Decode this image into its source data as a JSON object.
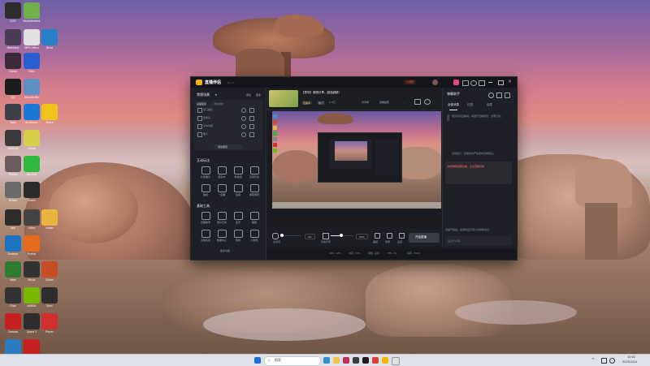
{
  "desktop": {
    "icons": [
      {
        "label": "iQIYI",
        "color": "#2c2c2c"
      },
      {
        "label": "BaiduNetdisk",
        "color": "#6fb04b"
      },
      {
        "label": "Mainland",
        "color": "#4a3c55"
      },
      {
        "label": "WPS Office",
        "color": "#e0e0e0"
      },
      {
        "label": "Drive",
        "color": "#2a80c8"
      },
      {
        "label": "Game",
        "color": "#3b2b3b"
      },
      {
        "label": "Files",
        "color": "#2a5fd1"
      },
      {
        "label": "QQ",
        "color": "#1d1d1d"
      },
      {
        "label": "Recycle Bin",
        "color": "#5e8fc4"
      },
      {
        "label": "Tools",
        "color": "#3d3f49"
      },
      {
        "label": "Bluetooth",
        "color": "#1b79d6"
      },
      {
        "label": "Share",
        "color": "#f0c21a"
      },
      {
        "label": "Settings",
        "color": "#3a3a3a"
      },
      {
        "label": "Guide",
        "color": "#d6cf4a"
      },
      {
        "label": "Photos",
        "color": "#6a5c5c"
      },
      {
        "label": "WeChat",
        "color": "#2fb93c"
      },
      {
        "label": "Helper",
        "color": "#6a6a6a"
      },
      {
        "label": "Zoom",
        "color": "#2b2b2b"
      },
      {
        "label": "App",
        "color": "#2c2c2c"
      },
      {
        "label": "Video",
        "color": "#444"
      },
      {
        "label": "Folder",
        "color": "#e8b43c"
      },
      {
        "label": "Browser",
        "color": "#1d73c2"
      },
      {
        "label": "Firefox",
        "color": "#e66a1c"
      },
      {
        "label": "Note",
        "color": "#2e7d32"
      },
      {
        "label": "Music",
        "color": "#333"
      },
      {
        "label": "Slides",
        "color": "#c74b25"
      },
      {
        "label": "Chat",
        "color": "#333"
      },
      {
        "label": "NVIDIA",
        "color": "#76b900"
      },
      {
        "label": "Sync",
        "color": "#2e2e2e"
      },
      {
        "label": "Camera",
        "color": "#c42020"
      },
      {
        "label": "Game 2",
        "color": "#2e2e2e"
      },
      {
        "label": "Player",
        "color": "#d32f2f"
      },
      {
        "label": "Calc",
        "color": "#2b7bc0"
      },
      {
        "label": "Reader",
        "color": "#c61f1f"
      }
    ]
  },
  "app": {
    "title": "直播伴侣",
    "version": "9.1.3",
    "top_badge": "十周年",
    "room_title": "【秀场】美照分享，越选越精！",
    "tag_live": "直播中",
    "tag_share": "热门",
    "tag_count": "1.2万",
    "btn_edit": "分享场",
    "btn_rank": "观看指南",
    "btn_more": "…",
    "scene_header": "常规场景",
    "add_label": "添加",
    "more_label": "更多",
    "scene_list_title": "画面图层",
    "scene_list_sub": "添加素材",
    "scene_items": [
      "窗口捕获",
      "摄像头",
      "文本内容",
      "图片"
    ],
    "add_scene_btn": "添加图层",
    "interact_title": "互动玩法",
    "interact_items": [
      "礼物展示",
      "连麦PK",
      "粉丝团",
      "互动玩法",
      "抽奖",
      "一起看",
      "投票",
      "弹幕游戏"
    ],
    "tools_title": "基础工具",
    "tools_items": [
      "直播助手",
      "观众互动",
      "金币",
      "美颜",
      "主播任务",
      "数据中心",
      "特效",
      "小游戏"
    ],
    "more_tools": "更多功能",
    "mic_label": "麦克风",
    "mic_value": "0%",
    "speaker_label": "系统声音",
    "speaker_value": "43%",
    "ctrl_icons": [
      "美颜",
      "录屏",
      "设置"
    ],
    "start_btn": "开始直播",
    "status_items": [
      "CPU: 12%",
      "内存: 34%",
      "网络: 良好",
      "FPS: 30",
      "码率: 3000"
    ],
    "right_title": "弹幕助手",
    "right_tabs": [
      "全部消息",
      "礼物",
      "连麦"
    ],
    "right_tab_active": "全部消息",
    "chat_lines": [
      "欢迎来到直播间，请遵守直播规范，文明互动。",
      "系统提示：直播间内严禁发布违规信息。"
    ],
    "chat_hint": "直播开始后，这里将显示观众的弹幕消息",
    "highlight_text": "新增弹幕提醒功能，点击查看详情",
    "input_placeholder": "说点什么吧…"
  },
  "taskbar": {
    "search_placeholder": "搜索",
    "time": "10:02",
    "date": "2025/10/4"
  }
}
